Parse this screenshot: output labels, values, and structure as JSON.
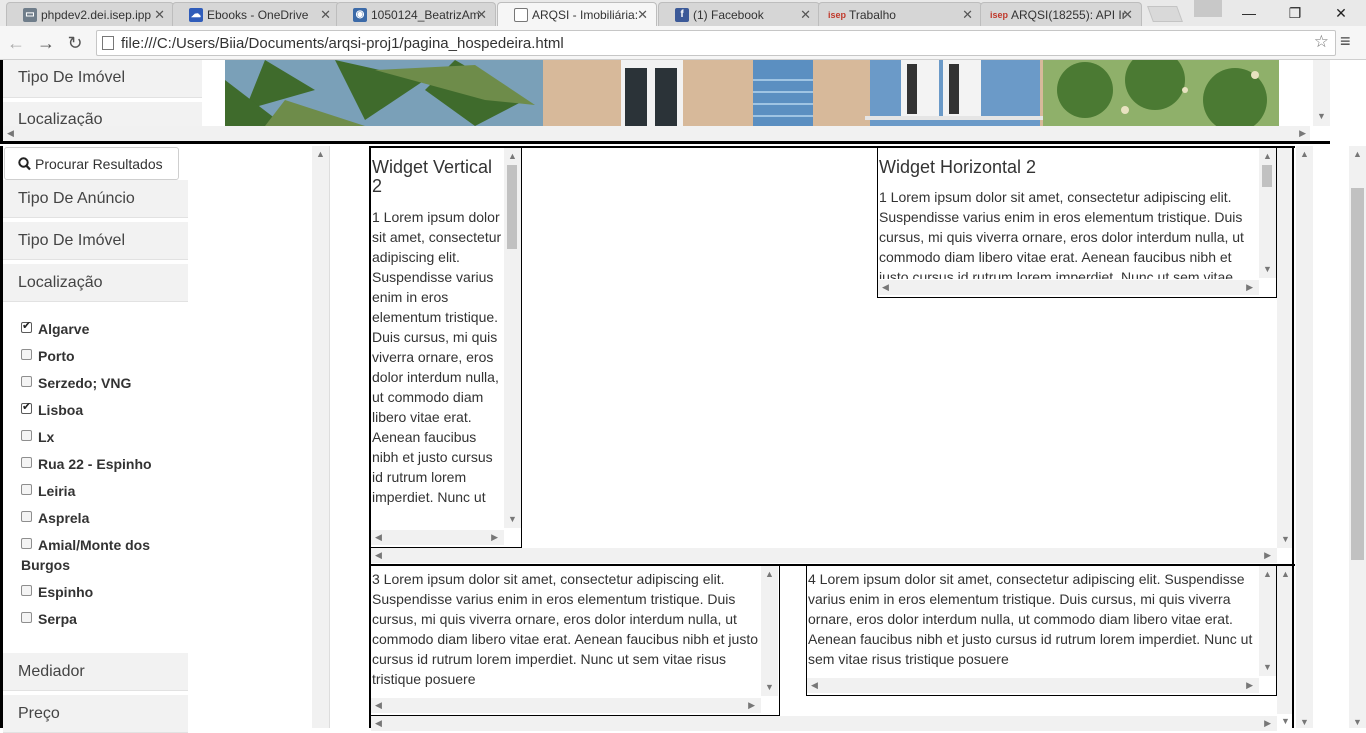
{
  "browser": {
    "tabs": [
      {
        "label": "phpdev2.dei.isep.ipp",
        "color": "#6f7d8a",
        "glyph": "▭"
      },
      {
        "label": "Ebooks - OneDrive",
        "color": "#2f5cba",
        "glyph": "☁"
      },
      {
        "label": "1050124_BeatrizAm",
        "color": "#3b6aa8",
        "glyph": "◉"
      },
      {
        "label": "ARQSI - Imobiliária:",
        "color": "#777777",
        "glyph": "▭"
      },
      {
        "label": "(1) Facebook",
        "color": "#3b5998",
        "glyph": "f"
      },
      {
        "label": "Trabalho",
        "color": "#c0392b",
        "glyph": "isep"
      },
      {
        "label": "ARQSI(18255): API Ir",
        "color": "#c0392b",
        "glyph": "isep"
      }
    ],
    "active_tab": 3,
    "url": "file:///C:/Users/Biia/Documents/arqsi-proj1/pagina_hospedeira.html",
    "controls": {
      "minimize": "—",
      "restore": "❐",
      "close": "✕"
    },
    "nav": {
      "back": "←",
      "forward": "→",
      "reload": "↻",
      "star": "☆",
      "menu": "≡"
    }
  },
  "top_frame": {
    "items": [
      "Tipo De Imóvel",
      "Localização"
    ]
  },
  "left_panel": {
    "search_button": "Procurar Resultados",
    "sections": [
      "Tipo De Anúncio",
      "Tipo De Imóvel",
      "Localização"
    ],
    "locations": [
      {
        "label": "Algarve",
        "checked": true
      },
      {
        "label": "Porto",
        "checked": false
      },
      {
        "label": "Serzedo; VNG",
        "checked": false
      },
      {
        "label": "Lisboa",
        "checked": true
      },
      {
        "label": "Lx",
        "checked": false
      },
      {
        "label": "Rua 22 - Espinho",
        "checked": false
      },
      {
        "label": "Leiria",
        "checked": false
      },
      {
        "label": "Asprela",
        "checked": false
      },
      {
        "label": "Amial/Monte dos",
        "checked": false,
        "continuation": "Burgos"
      },
      {
        "label": "Espinho",
        "checked": false
      },
      {
        "label": "Serpa",
        "checked": false
      }
    ],
    "bottom_sections": [
      "Mediador",
      "Preço"
    ]
  },
  "widgets": {
    "vertical2": {
      "title": "Widget Vertical 2",
      "body": "1 Lorem ipsum dolor sit amet, consectetur adipiscing elit. Suspendisse varius enim in eros elementum tristique. Duis cursus, mi quis viverra ornare, eros dolor interdum nulla, ut commodo diam libero vitae erat. Aenean faucibus nibh et justo cursus id rutrum lorem imperdiet. Nunc ut"
    },
    "horizontal2": {
      "title": "Widget Horizontal 2",
      "body": "1 Lorem ipsum dolor sit amet, consectetur adipiscing elit. Suspendisse varius enim in eros elementum tristique. Duis cursus, mi quis viverra ornare, eros dolor interdum nulla, ut commodo diam libero vitae erat. Aenean faucibus nibh et justo cursus id rutrum lorem imperdiet. Nunc ut sem vitae"
    },
    "bottom_left": {
      "body": "3 Lorem ipsum dolor sit amet, consectetur adipiscing elit. Suspendisse varius enim in eros elementum tristique. Duis cursus, mi quis viverra ornare, eros dolor interdum nulla, ut commodo diam libero vitae erat. Aenean faucibus nibh et justo cursus id rutrum lorem imperdiet. Nunc ut sem vitae risus tristique posuere"
    },
    "bottom_right": {
      "body": "4 Lorem ipsum dolor sit amet, consectetur adipiscing elit. Suspendisse varius enim in eros elementum tristique. Duis cursus, mi quis viverra ornare, eros dolor interdum nulla, ut commodo diam libero vitae erat. Aenean faucibus nibh et justo cursus id rutrum lorem imperdiet. Nunc ut sem vitae risus tristique posuere"
    }
  }
}
